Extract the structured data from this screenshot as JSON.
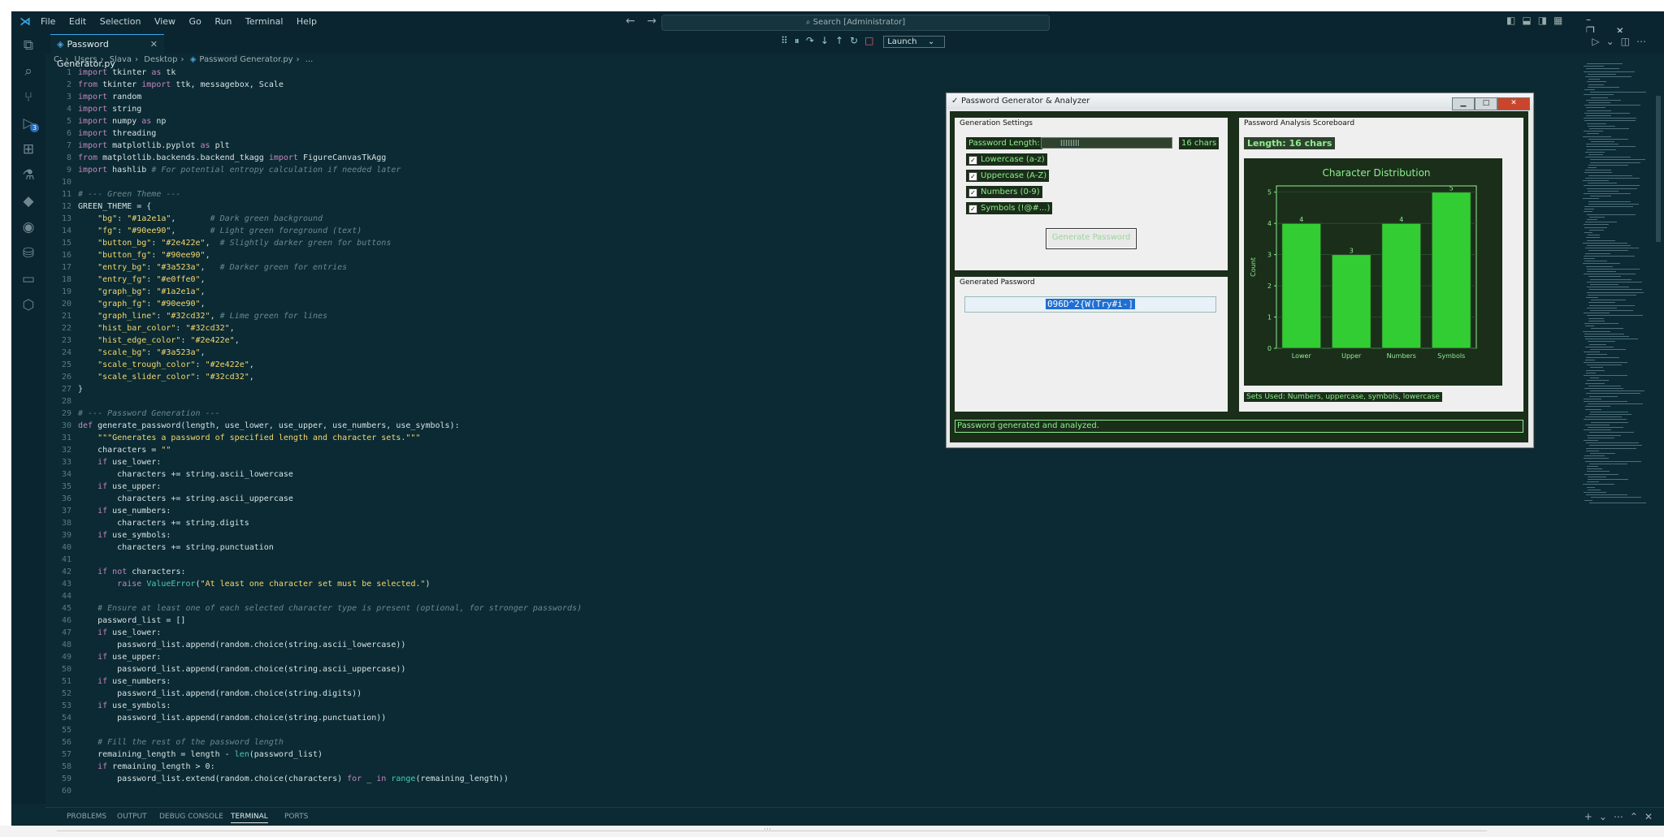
{
  "menu": {
    "items": [
      "File",
      "Edit",
      "Selection",
      "View",
      "Go",
      "Run",
      "Terminal",
      "Help"
    ],
    "search_placeholder": "Search [Administrator]"
  },
  "tab": {
    "label": "Password Generator.py"
  },
  "debug": {
    "launch_label": "Launch"
  },
  "breadcrumb": [
    "C:",
    "Users",
    "Slava",
    "Desktop",
    "Password Generator.py",
    "..."
  ],
  "code_lines": [
    {
      "n": "1",
      "t": "import tkinter as tk"
    },
    {
      "n": "2",
      "t": "from tkinter import ttk, messagebox, Scale"
    },
    {
      "n": "3",
      "t": "import random"
    },
    {
      "n": "4",
      "t": "import string"
    },
    {
      "n": "5",
      "t": "import numpy as np"
    },
    {
      "n": "6",
      "t": "import threading"
    },
    {
      "n": "7",
      "t": "import matplotlib.pyplot as plt"
    },
    {
      "n": "8",
      "t": "from matplotlib.backends.backend_tkagg import FigureCanvasTkAgg"
    },
    {
      "n": "9",
      "t": "import hashlib # For potential entropy calculation if needed later"
    },
    {
      "n": "10",
      "t": ""
    },
    {
      "n": "11",
      "t": "# --- Green Theme ---"
    },
    {
      "n": "12",
      "t": "GREEN_THEME = {"
    },
    {
      "n": "13",
      "t": "    \"bg\": \"#1a2e1a\",       # Dark green background"
    },
    {
      "n": "14",
      "t": "    \"fg\": \"#90ee90\",       # Light green foreground (text)"
    },
    {
      "n": "15",
      "t": "    \"button_bg\": \"#2e422e\",  # Slightly darker green for buttons"
    },
    {
      "n": "16",
      "t": "    \"button_fg\": \"#90ee90\","
    },
    {
      "n": "17",
      "t": "    \"entry_bg\": \"#3a523a\",   # Darker green for entries"
    },
    {
      "n": "18",
      "t": "    \"entry_fg\": \"#e0ffe0\","
    },
    {
      "n": "19",
      "t": "    \"graph_bg\": \"#1a2e1a\","
    },
    {
      "n": "20",
      "t": "    \"graph_fg\": \"#90ee90\","
    },
    {
      "n": "21",
      "t": "    \"graph_line\": \"#32cd32\", # Lime green for lines"
    },
    {
      "n": "22",
      "t": "    \"hist_bar_color\": \"#32cd32\","
    },
    {
      "n": "23",
      "t": "    \"hist_edge_color\": \"#2e422e\","
    },
    {
      "n": "24",
      "t": "    \"scale_bg\": \"#3a523a\","
    },
    {
      "n": "25",
      "t": "    \"scale_trough_color\": \"#2e422e\","
    },
    {
      "n": "26",
      "t": "    \"scale_slider_color\": \"#32cd32\","
    },
    {
      "n": "27",
      "t": "}"
    },
    {
      "n": "28",
      "t": ""
    },
    {
      "n": "29",
      "t": "# --- Password Generation ---"
    },
    {
      "n": "30",
      "t": "def generate_password(length, use_lower, use_upper, use_numbers, use_symbols):"
    },
    {
      "n": "31",
      "t": "    \"\"\"Generates a password of specified length and character sets.\"\"\""
    },
    {
      "n": "32",
      "t": "    characters = \"\""
    },
    {
      "n": "33",
      "t": "    if use_lower:"
    },
    {
      "n": "34",
      "t": "        characters += string.ascii_lowercase"
    },
    {
      "n": "35",
      "t": "    if use_upper:"
    },
    {
      "n": "36",
      "t": "        characters += string.ascii_uppercase"
    },
    {
      "n": "37",
      "t": "    if use_numbers:"
    },
    {
      "n": "38",
      "t": "        characters += string.digits"
    },
    {
      "n": "39",
      "t": "    if use_symbols:"
    },
    {
      "n": "40",
      "t": "        characters += string.punctuation"
    },
    {
      "n": "41",
      "t": ""
    },
    {
      "n": "42",
      "t": "    if not characters:"
    },
    {
      "n": "43",
      "t": "        raise ValueError(\"At least one character set must be selected.\")"
    },
    {
      "n": "44",
      "t": ""
    },
    {
      "n": "45",
      "t": "    # Ensure at least one of each selected character type is present (optional, for stronger passwords)"
    },
    {
      "n": "46",
      "t": "    password_list = []"
    },
    {
      "n": "47",
      "t": "    if use_lower:"
    },
    {
      "n": "48",
      "t": "        password_list.append(random.choice(string.ascii_lowercase))"
    },
    {
      "n": "49",
      "t": "    if use_upper:"
    },
    {
      "n": "50",
      "t": "        password_list.append(random.choice(string.ascii_uppercase))"
    },
    {
      "n": "51",
      "t": "    if use_numbers:"
    },
    {
      "n": "52",
      "t": "        password_list.append(random.choice(string.digits))"
    },
    {
      "n": "53",
      "t": "    if use_symbols:"
    },
    {
      "n": "54",
      "t": "        password_list.append(random.choice(string.punctuation))"
    },
    {
      "n": "55",
      "t": ""
    },
    {
      "n": "56",
      "t": "    # Fill the rest of the password length"
    },
    {
      "n": "57",
      "t": "    remaining_length = length - len(password_list)"
    },
    {
      "n": "58",
      "t": "    if remaining_length > 0:"
    },
    {
      "n": "59",
      "t": "        password_list.extend(random.choice(characters) for _ in range(remaining_length))"
    },
    {
      "n": "60",
      "t": ""
    }
  ],
  "panel_tabs": [
    "PROBLEMS",
    "OUTPUT",
    "DEBUG CONSOLE",
    "TERMINAL",
    "PORTS"
  ],
  "panel_active": "TERMINAL",
  "app": {
    "title": "Password Generator & Analyzer",
    "settings_title": "Generation Settings",
    "length_label": "Password Length:",
    "length_value": "16 chars",
    "length_fraction": 0.13,
    "checkboxes": [
      "Lowercase (a-z)",
      "Uppercase (A-Z)",
      "Numbers (0-9)",
      "Symbols (!@#...)"
    ],
    "generate_label": "Generate Password",
    "generated_title": "Generated Password",
    "password": "096D^2{W(Try#i-]",
    "scoreboard_title": "Password Analysis Scoreboard",
    "score_label": "Length: 16 chars",
    "sets_used": "Sets Used: Numbers, uppercase, symbols, lowercase",
    "status": "Password generated and analyzed."
  },
  "chart_data": {
    "type": "bar",
    "title": "Character Distribution",
    "categories": [
      "Lower",
      "Upper",
      "Numbers",
      "Symbols"
    ],
    "values": [
      4,
      3,
      4,
      5
    ],
    "ylabel": "Count",
    "xlabel": "",
    "ylim": [
      0,
      5.2
    ],
    "yticks": [
      0,
      1,
      2,
      3,
      4,
      5
    ],
    "bar_color": "#32cd32",
    "edge_color": "#2e422e",
    "text_color": "#90ee90",
    "bg": "#1a2e1a"
  }
}
